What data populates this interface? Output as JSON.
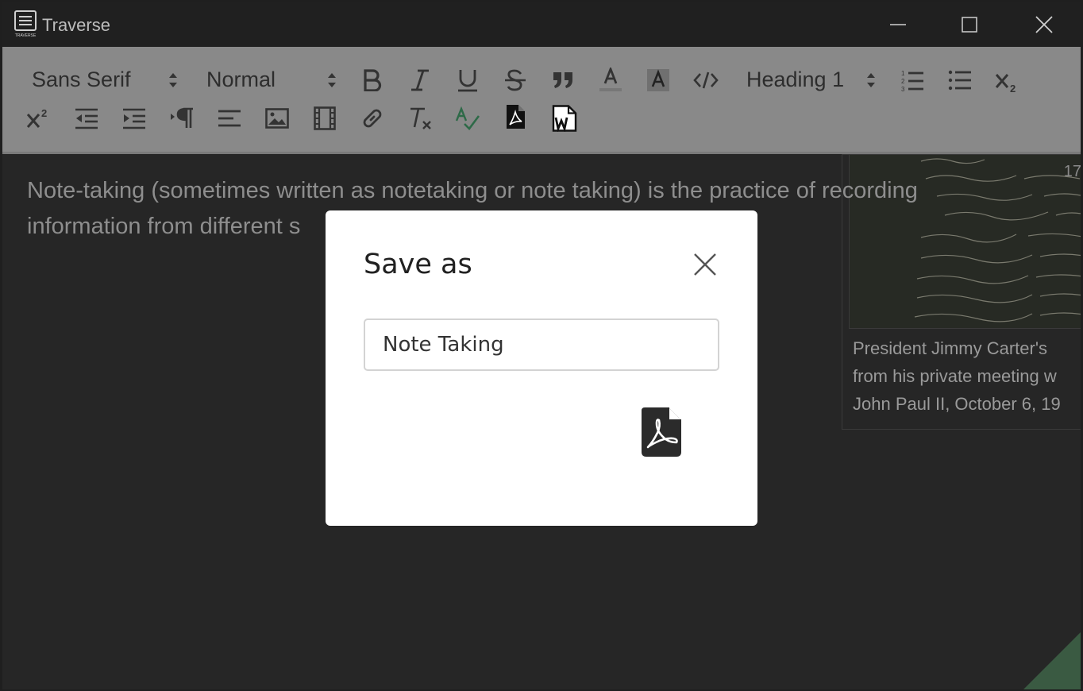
{
  "window": {
    "title": "Traverse",
    "app_icon_label": "TRAVERSE"
  },
  "toolbar": {
    "font_family_value": "Sans Serif",
    "font_size_value": "Normal",
    "heading_value": "Heading 1",
    "icons": [
      "bold-icon",
      "italic-icon",
      "underline-icon",
      "strikethrough-icon",
      "blockquote-icon",
      "text-color-icon",
      "background-color-icon",
      "code-icon",
      "ordered-list-icon",
      "bullet-list-icon",
      "subscript-icon",
      "superscript-icon",
      "outdent-icon",
      "indent-icon",
      "text-direction-icon",
      "align-icon",
      "image-icon",
      "video-icon",
      "link-icon",
      "clear-format-icon",
      "spellcheck-icon",
      "pdf-export-icon",
      "word-export-icon"
    ]
  },
  "editor": {
    "body_text": "Note-taking (sometimes written as notetaking or note taking) is the practice of recording information from different s",
    "figure_number": "17",
    "figure_caption_lines": [
      "President Jimmy Carter's",
      "from his private meeting w",
      "John Paul II, October 6, 19"
    ]
  },
  "dialog": {
    "title": "Save as",
    "filename_value": "Note Taking",
    "export_icon": "pdf-icon"
  },
  "colors": {
    "accent_corner": "#3a5a42",
    "toolbar_bg": "#898989",
    "editor_bg": "#262626",
    "text_color_icon_underline": "#777777",
    "spellcheck_color": "#2e6a48"
  }
}
